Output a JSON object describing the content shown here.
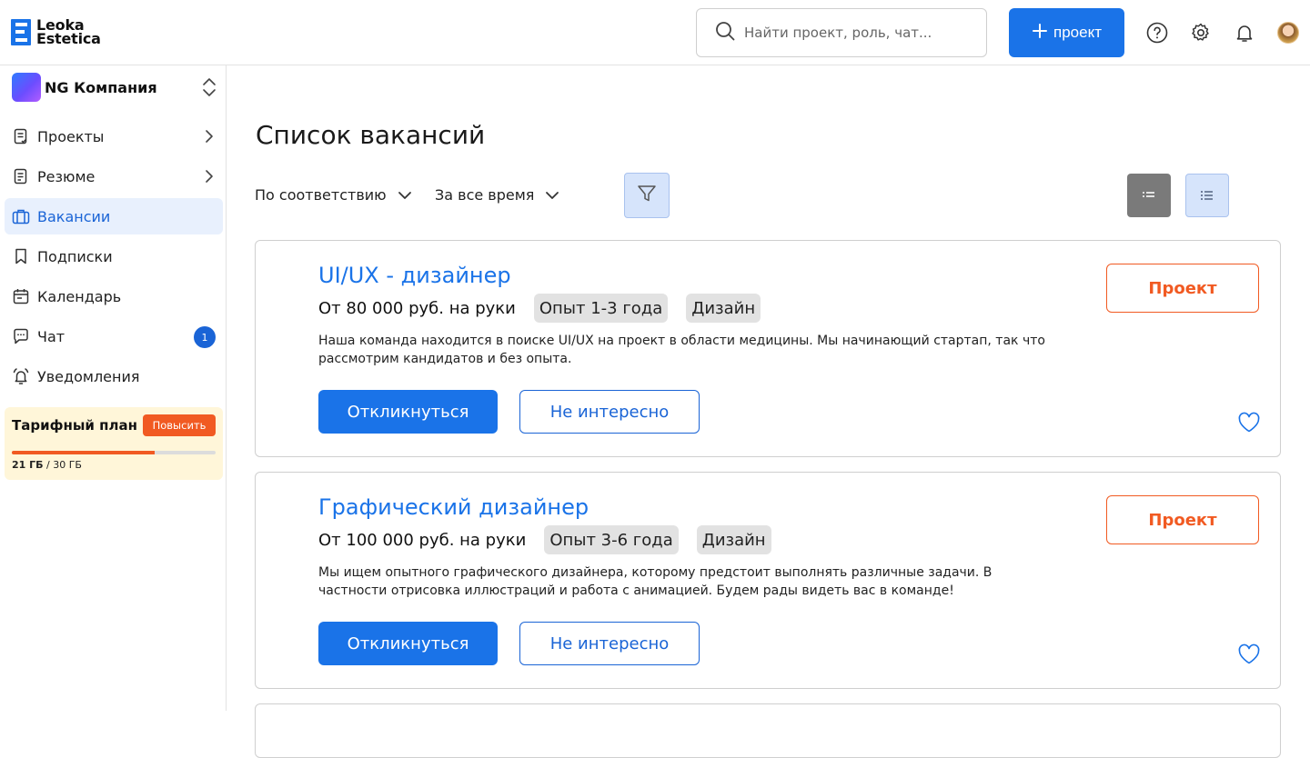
{
  "header": {
    "logo_line1": "Leoka",
    "logo_line2": "Estetica",
    "search_placeholder": "Найти проект, роль, чат...",
    "new_project_label": "проект",
    "icons": [
      "help-icon",
      "settings-icon",
      "bell-icon",
      "avatar"
    ]
  },
  "sidebar": {
    "company": "NG Компания",
    "items": [
      {
        "label": "Проекты",
        "icon": "projects-icon",
        "has_chevron": true
      },
      {
        "label": "Резюме",
        "icon": "resume-icon",
        "has_chevron": true
      },
      {
        "label": "Вакансии",
        "icon": "briefcase-icon",
        "active": true
      },
      {
        "label": "Подписки",
        "icon": "bookmark-icon"
      },
      {
        "label": "Календарь",
        "icon": "calendar-icon"
      },
      {
        "label": "Чат",
        "icon": "chat-icon",
        "badge": "1"
      },
      {
        "label": "Уведомления",
        "icon": "bell-icon"
      }
    ],
    "plan": {
      "title": "Тарифный план",
      "upgrade_label": "Повысить",
      "used": "21 ГБ",
      "total": "/ 30 ГБ",
      "used_fraction": 0.7
    }
  },
  "main": {
    "title": "Список вакансий",
    "sort": "По соответствию",
    "period": "За все время",
    "vacancies": [
      {
        "title": "UI/UX - дизайнер",
        "salary": "От 80 000 руб. на руки",
        "experience": "Опыт  1-3 года",
        "category": "Дизайн",
        "description": "Наша команда находится в поиске UI/UX на проект в области медицины. Мы начинающий стартап, так что рассмотрим кандидатов и без опыта.",
        "apply_label": "Откликнуться",
        "skip_label": "Не интересно",
        "project_label": "Проект"
      },
      {
        "title": "Графический дизайнер",
        "salary": "От 100 000 руб. на руки",
        "experience": "Опыт  3-6 года",
        "category": "Дизайн",
        "description": "Мы ищем опытного графического дизайнера, которому предстоит выполнять различные задачи. В частности отрисовка иллюстраций и работа с анимацией. Будем рады видеть вас в команде!",
        "apply_label": "Откликнуться",
        "skip_label": "Не интересно",
        "project_label": "Проект"
      }
    ]
  },
  "colors": {
    "accent": "#1a73e8",
    "orange": "#f15a22",
    "active_bg": "#e8f0fd",
    "plan_bg": "#fff6d9"
  }
}
